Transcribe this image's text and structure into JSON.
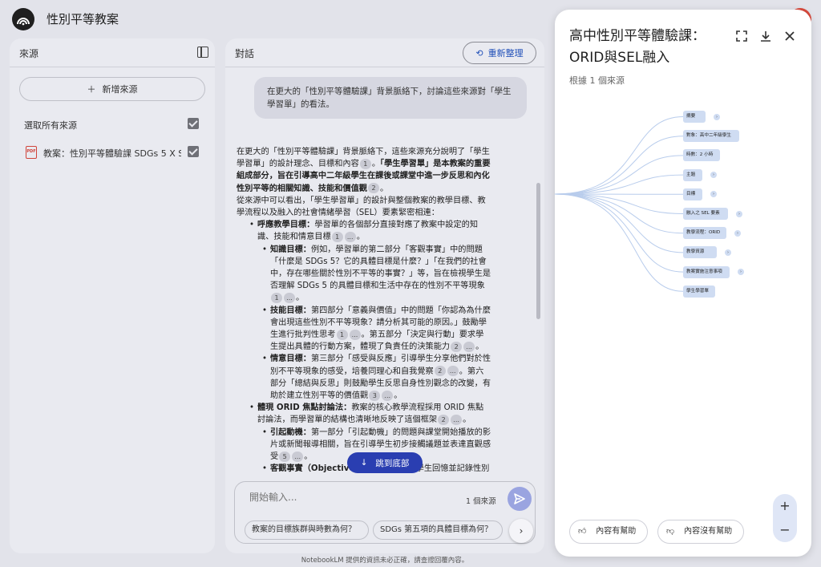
{
  "header": {
    "app_title": "性別平等教案"
  },
  "sources_panel": {
    "title": "來源",
    "add_source": "新增來源",
    "select_all": "選取所有來源",
    "items": [
      {
        "label": "教案：性別平等體驗課 SDGs 5 X S..."
      }
    ]
  },
  "chat_panel": {
    "title": "對話",
    "regenerate": "重新整理",
    "user_message": "在更大的「性別平等體驗課」背景脈絡下，討論這些來源對「學生學習單」的看法。",
    "answer": {
      "p1a": "在更大的「性別平等體驗課」背景脈絡下，這些來源充分說明了「學生學習單」的設計理念、目標和內容",
      "p1b": "。",
      "p1bold": "「學生學習單」是本教案的重要組成部分，旨在引導高中二年級學生在課後或課堂中進一步反思和內化性別平等的相關知識、技能和價值觀",
      "p1c": "。",
      "p2": "從來源中可以看出，「學生學習單」的設計與整個教案的教學目標、教學流程以及融入的社會情緒學習（SEL）要素緊密相連：",
      "b1_label": "呼應教學目標：",
      "b1_text": "學習單的各個部分直接對應了教案中設定的知識、技能和情意目標",
      "b1a_label": "知識目標：",
      "b1a_text": "例如，學習單的第二部分「客觀事實」中的問題「什麼是 SDGs 5？它的具體目標是什麼？」「在我們的社會中，存在哪些關於性別不平等的事實？」等，旨在檢視學生是否理解 SDGs 5 的具體目標和生活中存在的性別不平等現象",
      "b1b_label": "技能目標：",
      "b1b_text1": "第四部分「意義與價值」中的問題「你認為為什麼會出現這些性別不平等現象？請分析其可能的原因。」鼓勵學生進行批判性思考",
      "b1b_text2": "。第五部分「決定與行動」要求學生提出具體的行動方案，體現了負責任的決策能力",
      "b1c_label": "情意目標：",
      "b1c_text1": "第三部分「感受與反應」引導學生分享他們對於性別不平等現象的感受，培養同理心和自我覺察",
      "b1c_text2": "。第六部分「總結與反思」則鼓勵學生反思自身性別觀念的改變，有助於建立性別平等的價值觀",
      "b2_label": "體現 ORID 焦點討論法：",
      "b2_text": "教案的核心教學流程採用 ORID 焦點討論法，而學習單的結構也清晰地反映了這個框架",
      "b2a_label": "引起動機：",
      "b2a_text": "第一部分「引起動機」的問題與課堂開始播放的影片或新聞報導相關，旨在引導學生初步接觸議題並表達直觀感受",
      "b2b_label": "客觀事實（Objective）：",
      "b2b_text": "第二部分要求學生回憶並記錄性別",
      "cites": {
        "c1": "1",
        "c2": "2",
        "c3": "3",
        "c5": "5",
        "more": "..."
      }
    },
    "jump_to_bottom": "跳到底部",
    "input_placeholder": "開始輸入...",
    "source_count": "1 個來源",
    "suggestions": [
      "教案的目標族群與時數為何？",
      "SDGs 第五項的具體目標為何？"
    ]
  },
  "disclaimer": "NotebookLM 提供的資訊未必正確，請查證回覆內容。",
  "mind_map": {
    "title": "高中性別平等體驗課：ORID與SEL融入",
    "subtitle": "根據 1 個來源",
    "nodes": [
      {
        "label": "摘要",
        "expandable": true
      },
      {
        "label": "對象：高中二年級學生",
        "expandable": false
      },
      {
        "label": "時數：2 小時",
        "expandable": false
      },
      {
        "label": "主題",
        "expandable": true
      },
      {
        "label": "目標",
        "expandable": true
      },
      {
        "label": "融入之 SEL 要素",
        "expandable": true
      },
      {
        "label": "教學流程：ORID",
        "expandable": true
      },
      {
        "label": "教學資源",
        "expandable": true
      },
      {
        "label": "教案實施注意事項",
        "expandable": true
      },
      {
        "label": "學生學習單",
        "expandable": false
      }
    ],
    "feedback_helpful": "內容有幫助",
    "feedback_not_helpful": "內容沒有幫助",
    "zoom_in": "+",
    "zoom_out": "−"
  },
  "colors": {
    "accent": "#2a3eb1",
    "node_fill": "#cfdcf2",
    "link": "#b8ccec"
  }
}
